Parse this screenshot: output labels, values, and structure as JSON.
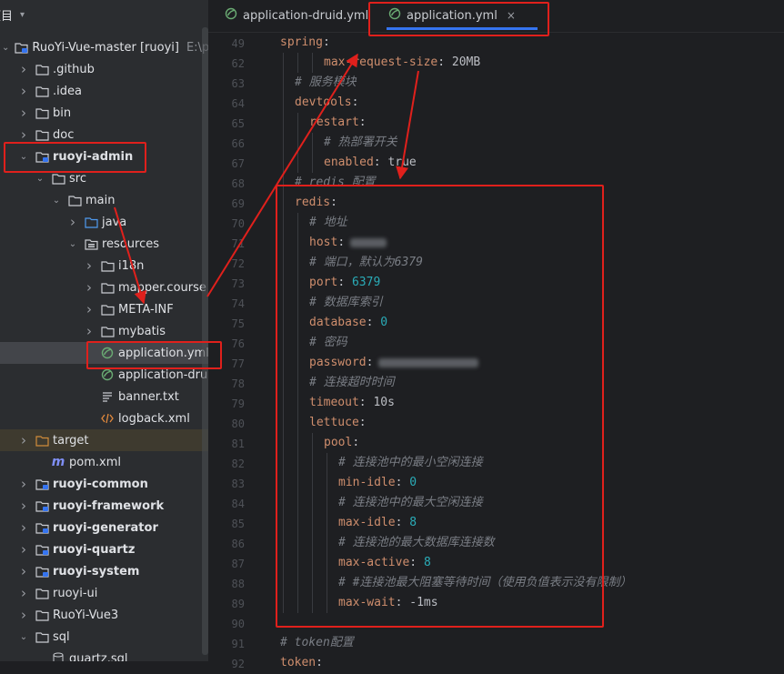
{
  "project": {
    "header_label": "项目",
    "tree": [
      {
        "label": "RuoYi-Vue-master [ruoyi]",
        "extra": "E:\\pers",
        "type": "module",
        "arrow": "down",
        "depth": 0,
        "bold": false,
        "icon": "module-icon"
      },
      {
        "label": ".github",
        "type": "folder",
        "arrow": "right",
        "depth": 1,
        "icon": "folder-icon"
      },
      {
        "label": ".idea",
        "type": "folder",
        "arrow": "right",
        "depth": 1,
        "icon": "folder-icon"
      },
      {
        "label": "bin",
        "type": "folder",
        "arrow": "right",
        "depth": 1,
        "icon": "folder-icon"
      },
      {
        "label": "doc",
        "type": "folder",
        "arrow": "right",
        "depth": 1,
        "icon": "folder-icon"
      },
      {
        "label": "ruoyi-admin",
        "type": "module",
        "arrow": "down",
        "depth": 1,
        "bold": true,
        "icon": "module-folder-icon"
      },
      {
        "label": "src",
        "type": "folder",
        "arrow": "down",
        "depth": 2,
        "icon": "folder-icon"
      },
      {
        "label": "main",
        "type": "folder",
        "arrow": "down",
        "depth": 3,
        "icon": "folder-icon"
      },
      {
        "label": "java",
        "type": "folder",
        "arrow": "right",
        "depth": 4,
        "icon": "source-folder-icon"
      },
      {
        "label": "resources",
        "type": "folder",
        "arrow": "down",
        "depth": 4,
        "icon": "resources-folder-icon"
      },
      {
        "label": "i18n",
        "type": "folder",
        "arrow": "right",
        "depth": 5,
        "icon": "folder-icon"
      },
      {
        "label": "mapper.course",
        "type": "folder",
        "arrow": "right",
        "depth": 5,
        "icon": "folder-icon"
      },
      {
        "label": "META-INF",
        "type": "folder",
        "arrow": "right",
        "depth": 5,
        "icon": "folder-icon"
      },
      {
        "label": "mybatis",
        "type": "folder",
        "arrow": "right",
        "depth": 5,
        "icon": "folder-icon"
      },
      {
        "label": "application.yml",
        "type": "file",
        "arrow": "none",
        "depth": 5,
        "icon": "spring-yml-icon",
        "selected": true
      },
      {
        "label": "application-druid",
        "type": "file",
        "arrow": "none",
        "depth": 5,
        "icon": "spring-yml-icon"
      },
      {
        "label": "banner.txt",
        "type": "file",
        "arrow": "none",
        "depth": 5,
        "icon": "text-file-icon"
      },
      {
        "label": "logback.xml",
        "type": "file",
        "arrow": "none",
        "depth": 5,
        "icon": "xml-file-icon"
      },
      {
        "label": "target",
        "type": "folder",
        "arrow": "right",
        "depth": 1,
        "icon": "excluded-folder-icon",
        "target": true
      },
      {
        "label": "pom.xml",
        "type": "file",
        "arrow": "none",
        "depth": 2,
        "icon": "maven-icon"
      },
      {
        "label": "ruoyi-common",
        "type": "module",
        "arrow": "right",
        "depth": 1,
        "bold": true,
        "icon": "module-folder-icon"
      },
      {
        "label": "ruoyi-framework",
        "type": "module",
        "arrow": "right",
        "depth": 1,
        "bold": true,
        "icon": "module-folder-icon"
      },
      {
        "label": "ruoyi-generator",
        "type": "module",
        "arrow": "right",
        "depth": 1,
        "bold": true,
        "icon": "module-folder-icon"
      },
      {
        "label": "ruoyi-quartz",
        "type": "module",
        "arrow": "right",
        "depth": 1,
        "bold": true,
        "icon": "module-folder-icon"
      },
      {
        "label": "ruoyi-system",
        "type": "module",
        "arrow": "right",
        "depth": 1,
        "bold": true,
        "icon": "module-folder-icon"
      },
      {
        "label": "ruoyi-ui",
        "type": "folder",
        "arrow": "right",
        "depth": 1,
        "icon": "folder-icon"
      },
      {
        "label": "RuoYi-Vue3",
        "type": "folder",
        "arrow": "right",
        "depth": 1,
        "icon": "folder-icon"
      },
      {
        "label": "sql",
        "type": "folder",
        "arrow": "down",
        "depth": 1,
        "icon": "folder-icon"
      },
      {
        "label": "quartz.sql",
        "type": "file",
        "arrow": "none",
        "depth": 2,
        "icon": "sql-file-icon"
      }
    ]
  },
  "tabs": [
    {
      "label": "application-druid.yml",
      "active": false,
      "icon": "spring-yml-icon"
    },
    {
      "label": "application.yml",
      "active": true,
      "icon": "spring-yml-icon",
      "close": "×"
    }
  ],
  "editor": {
    "lines": [
      {
        "n": "49",
        "indent": 0,
        "parts": [
          {
            "c": "k",
            "t": "spring"
          },
          {
            "c": "p",
            "t": ":"
          }
        ]
      },
      {
        "n": "62",
        "indent": 3,
        "parts": [
          {
            "c": "k",
            "t": "max-request-size"
          },
          {
            "c": "p",
            "t": ": 20MB"
          }
        ]
      },
      {
        "n": "63",
        "indent": 1,
        "parts": [
          {
            "c": "cm",
            "t": "# 服务模块"
          }
        ]
      },
      {
        "n": "64",
        "indent": 1,
        "parts": [
          {
            "c": "k",
            "t": "devtools"
          },
          {
            "c": "p",
            "t": ":"
          }
        ]
      },
      {
        "n": "65",
        "indent": 2,
        "parts": [
          {
            "c": "k",
            "t": "restart"
          },
          {
            "c": "p",
            "t": ":"
          }
        ]
      },
      {
        "n": "66",
        "indent": 3,
        "parts": [
          {
            "c": "cm",
            "t": "# 热部署开关"
          }
        ]
      },
      {
        "n": "67",
        "indent": 3,
        "parts": [
          {
            "c": "k",
            "t": "enabled"
          },
          {
            "c": "p",
            "t": ": true"
          }
        ]
      },
      {
        "n": "68",
        "indent": 1,
        "parts": [
          {
            "c": "cm",
            "t": "# redis 配置"
          }
        ]
      },
      {
        "n": "69",
        "indent": 1,
        "parts": [
          {
            "c": "k",
            "t": "redis"
          },
          {
            "c": "p",
            "t": ":"
          }
        ]
      },
      {
        "n": "70",
        "indent": 2,
        "parts": [
          {
            "c": "cm",
            "t": "# 地址"
          }
        ]
      },
      {
        "n": "71",
        "indent": 2,
        "parts": [
          {
            "c": "k",
            "t": "host"
          },
          {
            "c": "p",
            "t": ":"
          }
        ],
        "blur": 40
      },
      {
        "n": "72",
        "indent": 2,
        "parts": [
          {
            "c": "cm",
            "t": "# 端口，默认为6379"
          }
        ]
      },
      {
        "n": "73",
        "indent": 2,
        "parts": [
          {
            "c": "k",
            "t": "port"
          },
          {
            "c": "p",
            "t": ": "
          },
          {
            "c": "num",
            "t": "6379"
          }
        ]
      },
      {
        "n": "74",
        "indent": 2,
        "parts": [
          {
            "c": "cm",
            "t": "# 数据库索引"
          }
        ]
      },
      {
        "n": "75",
        "indent": 2,
        "parts": [
          {
            "c": "k",
            "t": "database"
          },
          {
            "c": "p",
            "t": ": "
          },
          {
            "c": "num",
            "t": "0"
          }
        ]
      },
      {
        "n": "76",
        "indent": 2,
        "parts": [
          {
            "c": "cm",
            "t": "# 密码"
          }
        ]
      },
      {
        "n": "77",
        "indent": 2,
        "parts": [
          {
            "c": "k",
            "t": "password"
          },
          {
            "c": "p",
            "t": ":"
          }
        ],
        "blur": 110
      },
      {
        "n": "78",
        "indent": 2,
        "parts": [
          {
            "c": "cm",
            "t": "# 连接超时时间"
          }
        ]
      },
      {
        "n": "79",
        "indent": 2,
        "parts": [
          {
            "c": "k",
            "t": "timeout"
          },
          {
            "c": "p",
            "t": ": 10s"
          }
        ]
      },
      {
        "n": "80",
        "indent": 2,
        "parts": [
          {
            "c": "k",
            "t": "lettuce"
          },
          {
            "c": "p",
            "t": ":"
          }
        ]
      },
      {
        "n": "81",
        "indent": 3,
        "parts": [
          {
            "c": "k",
            "t": "pool"
          },
          {
            "c": "p",
            "t": ":"
          }
        ]
      },
      {
        "n": "82",
        "indent": 4,
        "parts": [
          {
            "c": "cm",
            "t": "# 连接池中的最小空闲连接"
          }
        ]
      },
      {
        "n": "83",
        "indent": 4,
        "parts": [
          {
            "c": "k",
            "t": "min-idle"
          },
          {
            "c": "p",
            "t": ": "
          },
          {
            "c": "num",
            "t": "0"
          }
        ]
      },
      {
        "n": "84",
        "indent": 4,
        "parts": [
          {
            "c": "cm",
            "t": "# 连接池中的最大空闲连接"
          }
        ]
      },
      {
        "n": "85",
        "indent": 4,
        "parts": [
          {
            "c": "k",
            "t": "max-idle"
          },
          {
            "c": "p",
            "t": ": "
          },
          {
            "c": "num",
            "t": "8"
          }
        ]
      },
      {
        "n": "86",
        "indent": 4,
        "parts": [
          {
            "c": "cm",
            "t": "# 连接池的最大数据库连接数"
          }
        ]
      },
      {
        "n": "87",
        "indent": 4,
        "parts": [
          {
            "c": "k",
            "t": "max-active"
          },
          {
            "c": "p",
            "t": ": "
          },
          {
            "c": "num",
            "t": "8"
          }
        ]
      },
      {
        "n": "88",
        "indent": 4,
        "parts": [
          {
            "c": "cm",
            "t": "# #连接池最大阻塞等待时间（使用负值表示没有限制）"
          }
        ]
      },
      {
        "n": "89",
        "indent": 4,
        "parts": [
          {
            "c": "k",
            "t": "max-wait"
          },
          {
            "c": "p",
            "t": ": -1ms"
          }
        ]
      },
      {
        "n": "90",
        "indent": 0,
        "parts": []
      },
      {
        "n": "91",
        "indent": 0,
        "parts": [
          {
            "c": "cm",
            "t": "# token配置"
          }
        ]
      },
      {
        "n": "92",
        "indent": 0,
        "parts": [
          {
            "c": "k",
            "t": "token"
          },
          {
            "c": "p",
            "t": ":"
          }
        ]
      }
    ]
  },
  "colors": {
    "annotation": "#e0201c",
    "tab_underline": "#3574f0",
    "keyword": "#cf8e6d",
    "number": "#2aacb8",
    "comment": "#7a7e85"
  }
}
